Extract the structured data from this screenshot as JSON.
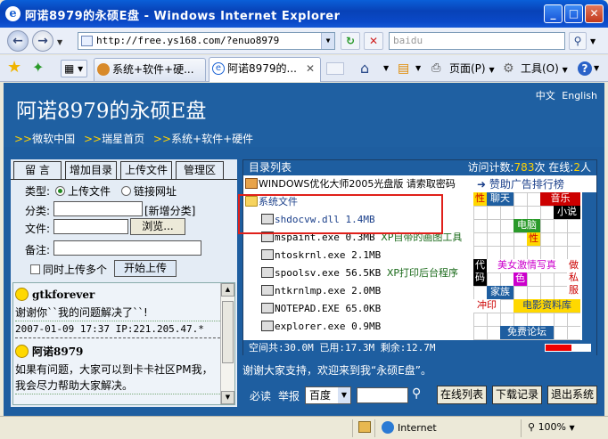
{
  "window": {
    "title": "阿诺8979的永硕E盘 - Windows Internet Explorer",
    "icon": "ie-icon"
  },
  "window_controls": {
    "minimize": "_",
    "maximize": "□",
    "close": "✕"
  },
  "nav": {
    "url": "http://free.ys168.com/?enuo8979",
    "search_placeholder": "baidu"
  },
  "tabs": [
    {
      "label": "系统+软件+硬..."
    },
    {
      "label": "阿诺8979的..."
    }
  ],
  "commands": {
    "page": "页面(P)",
    "tools": "工具(O)"
  },
  "header": {
    "title": "阿诺8979的永硕E盘",
    "lang_cn": "中文",
    "lang_en": "English",
    "links": [
      "微软中国",
      "瑞星首页",
      "系统+软件+硬件"
    ]
  },
  "left_tabs": [
    "留  言",
    "增加目录",
    "上传文件",
    "管理区"
  ],
  "upload_form": {
    "type_label": "类型:",
    "option_upload": "上传文件",
    "option_link": "链接网址",
    "category_label": "分类:",
    "new_category": "[新增分类]",
    "file_label": "文件:",
    "browse": "浏览...",
    "note_label": "备注:",
    "multi_upload": "同时上传多个",
    "start_upload": "开始上传"
  },
  "messages": [
    {
      "name": "gtkforever",
      "text": "谢谢你``我的问题解决了``!",
      "date": "2007-01-09 17:37 IP:221.205.47.*"
    },
    {
      "name": "阿诺8979",
      "text": "如果有问题，大家可以到卡卡社区PM我，我会尽力帮助大家解决。"
    }
  ],
  "file_panel": {
    "title": "目录列表",
    "visits_label": "访问计数:",
    "visits": "783",
    "visits_unit": "次",
    "online_label": "在线:",
    "online": "2",
    "online_unit": "人",
    "rows": [
      {
        "icon": "lock-icon",
        "name": "WINDOWS优化大师2005光盘版 请索取密码",
        "size": "",
        "note": ""
      },
      {
        "icon": "folder-icon",
        "name": "系统文件",
        "size": "",
        "note": ""
      },
      {
        "icon": "file-icon",
        "name": "shdocvw.dll",
        "size": "1.4MB",
        "note": ""
      },
      {
        "icon": "file-icon",
        "name": "mspaint.exe",
        "size": "0.3MB",
        "note": "XP自带的画图工具"
      },
      {
        "icon": "file-icon",
        "name": "ntoskrnl.exe",
        "size": "2.1MB",
        "note": ""
      },
      {
        "icon": "file-icon",
        "name": "spoolsv.exe",
        "size": "56.5KB",
        "note": "XP打印后台程序"
      },
      {
        "icon": "file-icon",
        "name": "ntkrnlmp.exe",
        "size": "2.0MB",
        "note": ""
      },
      {
        "icon": "file-icon",
        "name": "NOTEPAD.EXE",
        "size": "65.0KB",
        "note": ""
      },
      {
        "icon": "file-icon",
        "name": "explorer.exe",
        "size": "0.9MB",
        "note": ""
      }
    ],
    "ad_title": "赞助广告排行榜",
    "ads": [
      "性",
      "聊天",
      "音乐",
      "小说",
      "电脑",
      "性",
      "代码",
      "美女激情写真",
      "做私服",
      "色",
      "家族",
      "冲印",
      "电影资料库",
      "免费论坛"
    ],
    "status": {
      "space_label": "空间共:",
      "space_total": "30.0M",
      "used_label": "已用:",
      "used": "17.3M",
      "remaining_label": "剩余:",
      "remaining": "12.7M"
    },
    "used_fraction": 0.577
  },
  "welcome": "谢谢大家支持，欢迎来到我“永硕E盘”。",
  "bottom": {
    "bidu": "必读",
    "report": "举报",
    "search_engine": "百度",
    "online_list": "在线列表",
    "download_log": "下载记录",
    "logout": "退出系统"
  },
  "status_bar": {
    "zone": "Internet",
    "zoom": "100%"
  },
  "colors": {
    "page_bg": "#1e5ea0",
    "highlight": "#e0201a",
    "link_arrow": "#ffd200"
  }
}
